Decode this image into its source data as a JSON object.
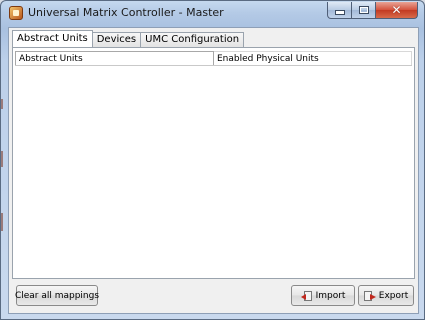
{
  "window": {
    "title": "Universal Matrix Controller - Master",
    "app_icon": "app-icon",
    "controls": {
      "minimize_icon": "minimize-icon",
      "maximize_icon": "maximize-icon",
      "close_glyph": "✕"
    }
  },
  "tabs": [
    {
      "label": "Abstract Units",
      "active": true
    },
    {
      "label": "Devices",
      "active": false
    },
    {
      "label": "UMC Configuration",
      "active": false
    }
  ],
  "table": {
    "columns": [
      "Abstract Units",
      "Enabled Physical Units"
    ],
    "rows": []
  },
  "buttons": {
    "clear": "Clear all mappings",
    "import": "Import",
    "export": "Export",
    "import_icon": "import-icon",
    "export_icon": "export-icon"
  },
  "colors": {
    "window_frame": "#b4cae6",
    "close_button": "#d4513b",
    "panel_bg": "#ffffff"
  }
}
